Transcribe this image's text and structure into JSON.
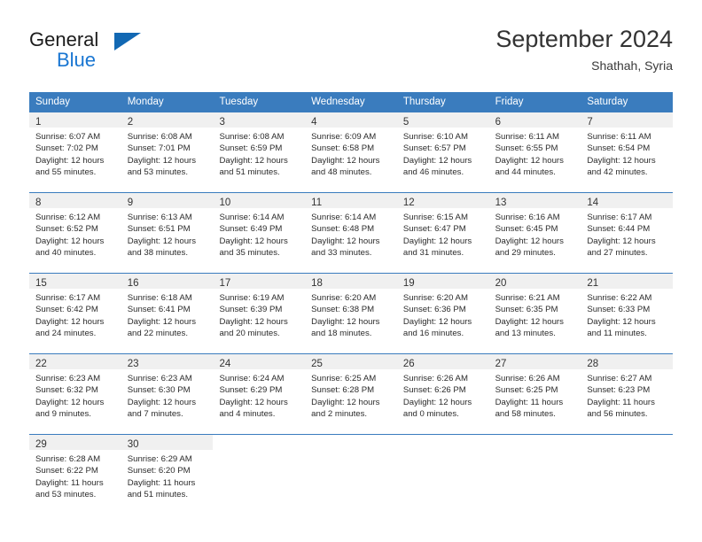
{
  "brand": {
    "name_top": "General",
    "name_bottom": "Blue",
    "accent_color": "#1976d2",
    "triangle_color": "#1268b3"
  },
  "header": {
    "title": "September 2024",
    "location": "Shathah, Syria"
  },
  "calendar": {
    "header_bg": "#3a7cbe",
    "daynum_band_bg": "#f0f0f0",
    "weekdays": [
      "Sunday",
      "Monday",
      "Tuesday",
      "Wednesday",
      "Thursday",
      "Friday",
      "Saturday"
    ],
    "weeks": [
      [
        {
          "day": "1",
          "sunrise": "Sunrise: 6:07 AM",
          "sunset": "Sunset: 7:02 PM",
          "daylight1": "Daylight: 12 hours",
          "daylight2": "and 55 minutes."
        },
        {
          "day": "2",
          "sunrise": "Sunrise: 6:08 AM",
          "sunset": "Sunset: 7:01 PM",
          "daylight1": "Daylight: 12 hours",
          "daylight2": "and 53 minutes."
        },
        {
          "day": "3",
          "sunrise": "Sunrise: 6:08 AM",
          "sunset": "Sunset: 6:59 PM",
          "daylight1": "Daylight: 12 hours",
          "daylight2": "and 51 minutes."
        },
        {
          "day": "4",
          "sunrise": "Sunrise: 6:09 AM",
          "sunset": "Sunset: 6:58 PM",
          "daylight1": "Daylight: 12 hours",
          "daylight2": "and 48 minutes."
        },
        {
          "day": "5",
          "sunrise": "Sunrise: 6:10 AM",
          "sunset": "Sunset: 6:57 PM",
          "daylight1": "Daylight: 12 hours",
          "daylight2": "and 46 minutes."
        },
        {
          "day": "6",
          "sunrise": "Sunrise: 6:11 AM",
          "sunset": "Sunset: 6:55 PM",
          "daylight1": "Daylight: 12 hours",
          "daylight2": "and 44 minutes."
        },
        {
          "day": "7",
          "sunrise": "Sunrise: 6:11 AM",
          "sunset": "Sunset: 6:54 PM",
          "daylight1": "Daylight: 12 hours",
          "daylight2": "and 42 minutes."
        }
      ],
      [
        {
          "day": "8",
          "sunrise": "Sunrise: 6:12 AM",
          "sunset": "Sunset: 6:52 PM",
          "daylight1": "Daylight: 12 hours",
          "daylight2": "and 40 minutes."
        },
        {
          "day": "9",
          "sunrise": "Sunrise: 6:13 AM",
          "sunset": "Sunset: 6:51 PM",
          "daylight1": "Daylight: 12 hours",
          "daylight2": "and 38 minutes."
        },
        {
          "day": "10",
          "sunrise": "Sunrise: 6:14 AM",
          "sunset": "Sunset: 6:49 PM",
          "daylight1": "Daylight: 12 hours",
          "daylight2": "and 35 minutes."
        },
        {
          "day": "11",
          "sunrise": "Sunrise: 6:14 AM",
          "sunset": "Sunset: 6:48 PM",
          "daylight1": "Daylight: 12 hours",
          "daylight2": "and 33 minutes."
        },
        {
          "day": "12",
          "sunrise": "Sunrise: 6:15 AM",
          "sunset": "Sunset: 6:47 PM",
          "daylight1": "Daylight: 12 hours",
          "daylight2": "and 31 minutes."
        },
        {
          "day": "13",
          "sunrise": "Sunrise: 6:16 AM",
          "sunset": "Sunset: 6:45 PM",
          "daylight1": "Daylight: 12 hours",
          "daylight2": "and 29 minutes."
        },
        {
          "day": "14",
          "sunrise": "Sunrise: 6:17 AM",
          "sunset": "Sunset: 6:44 PM",
          "daylight1": "Daylight: 12 hours",
          "daylight2": "and 27 minutes."
        }
      ],
      [
        {
          "day": "15",
          "sunrise": "Sunrise: 6:17 AM",
          "sunset": "Sunset: 6:42 PM",
          "daylight1": "Daylight: 12 hours",
          "daylight2": "and 24 minutes."
        },
        {
          "day": "16",
          "sunrise": "Sunrise: 6:18 AM",
          "sunset": "Sunset: 6:41 PM",
          "daylight1": "Daylight: 12 hours",
          "daylight2": "and 22 minutes."
        },
        {
          "day": "17",
          "sunrise": "Sunrise: 6:19 AM",
          "sunset": "Sunset: 6:39 PM",
          "daylight1": "Daylight: 12 hours",
          "daylight2": "and 20 minutes."
        },
        {
          "day": "18",
          "sunrise": "Sunrise: 6:20 AM",
          "sunset": "Sunset: 6:38 PM",
          "daylight1": "Daylight: 12 hours",
          "daylight2": "and 18 minutes."
        },
        {
          "day": "19",
          "sunrise": "Sunrise: 6:20 AM",
          "sunset": "Sunset: 6:36 PM",
          "daylight1": "Daylight: 12 hours",
          "daylight2": "and 16 minutes."
        },
        {
          "day": "20",
          "sunrise": "Sunrise: 6:21 AM",
          "sunset": "Sunset: 6:35 PM",
          "daylight1": "Daylight: 12 hours",
          "daylight2": "and 13 minutes."
        },
        {
          "day": "21",
          "sunrise": "Sunrise: 6:22 AM",
          "sunset": "Sunset: 6:33 PM",
          "daylight1": "Daylight: 12 hours",
          "daylight2": "and 11 minutes."
        }
      ],
      [
        {
          "day": "22",
          "sunrise": "Sunrise: 6:23 AM",
          "sunset": "Sunset: 6:32 PM",
          "daylight1": "Daylight: 12 hours",
          "daylight2": "and 9 minutes."
        },
        {
          "day": "23",
          "sunrise": "Sunrise: 6:23 AM",
          "sunset": "Sunset: 6:30 PM",
          "daylight1": "Daylight: 12 hours",
          "daylight2": "and 7 minutes."
        },
        {
          "day": "24",
          "sunrise": "Sunrise: 6:24 AM",
          "sunset": "Sunset: 6:29 PM",
          "daylight1": "Daylight: 12 hours",
          "daylight2": "and 4 minutes."
        },
        {
          "day": "25",
          "sunrise": "Sunrise: 6:25 AM",
          "sunset": "Sunset: 6:28 PM",
          "daylight1": "Daylight: 12 hours",
          "daylight2": "and 2 minutes."
        },
        {
          "day": "26",
          "sunrise": "Sunrise: 6:26 AM",
          "sunset": "Sunset: 6:26 PM",
          "daylight1": "Daylight: 12 hours",
          "daylight2": "and 0 minutes."
        },
        {
          "day": "27",
          "sunrise": "Sunrise: 6:26 AM",
          "sunset": "Sunset: 6:25 PM",
          "daylight1": "Daylight: 11 hours",
          "daylight2": "and 58 minutes."
        },
        {
          "day": "28",
          "sunrise": "Sunrise: 6:27 AM",
          "sunset": "Sunset: 6:23 PM",
          "daylight1": "Daylight: 11 hours",
          "daylight2": "and 56 minutes."
        }
      ],
      [
        {
          "day": "29",
          "sunrise": "Sunrise: 6:28 AM",
          "sunset": "Sunset: 6:22 PM",
          "daylight1": "Daylight: 11 hours",
          "daylight2": "and 53 minutes."
        },
        {
          "day": "30",
          "sunrise": "Sunrise: 6:29 AM",
          "sunset": "Sunset: 6:20 PM",
          "daylight1": "Daylight: 11 hours",
          "daylight2": "and 51 minutes."
        },
        {
          "day": "",
          "sunrise": "",
          "sunset": "",
          "daylight1": "",
          "daylight2": ""
        },
        {
          "day": "",
          "sunrise": "",
          "sunset": "",
          "daylight1": "",
          "daylight2": ""
        },
        {
          "day": "",
          "sunrise": "",
          "sunset": "",
          "daylight1": "",
          "daylight2": ""
        },
        {
          "day": "",
          "sunrise": "",
          "sunset": "",
          "daylight1": "",
          "daylight2": ""
        },
        {
          "day": "",
          "sunrise": "",
          "sunset": "",
          "daylight1": "",
          "daylight2": ""
        }
      ]
    ]
  }
}
